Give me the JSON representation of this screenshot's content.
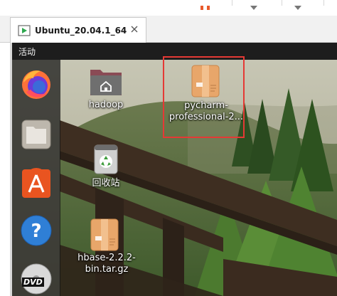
{
  "host": {
    "tab": {
      "label": "Ubuntu_20.04.1_64"
    }
  },
  "ubuntu": {
    "panel": {
      "activities_label": "活动"
    },
    "dock": {
      "items": [
        {
          "name": "Firefox",
          "icon": "firefox-icon"
        },
        {
          "name": "Files",
          "icon": "files-icon"
        },
        {
          "name": "Software",
          "icon": "software-store-icon"
        },
        {
          "name": "Help",
          "icon": "help-icon"
        },
        {
          "name": "DVD",
          "icon": "dvd-icon",
          "badge": "DVD"
        }
      ]
    },
    "desktop": {
      "icons": [
        {
          "label_lines": [
            "hadoop"
          ],
          "icon": "home-folder-icon"
        },
        {
          "label_lines": [
            "pycharm-",
            "professional-2..."
          ],
          "icon": "archive-icon",
          "selected": true
        },
        {
          "label_lines": [
            "回收站"
          ],
          "icon": "trash-icon"
        },
        {
          "label_lines": [
            "hbase-2.2.2-",
            "bin.tar.gz"
          ],
          "icon": "archive-icon"
        }
      ]
    }
  },
  "colors": {
    "panel_bg": "#1d1d1d",
    "selection_outline": "#e53935",
    "archive_orange": "#e8a66a",
    "help_blue": "#2f7fd6",
    "software_orange": "#e95420"
  }
}
